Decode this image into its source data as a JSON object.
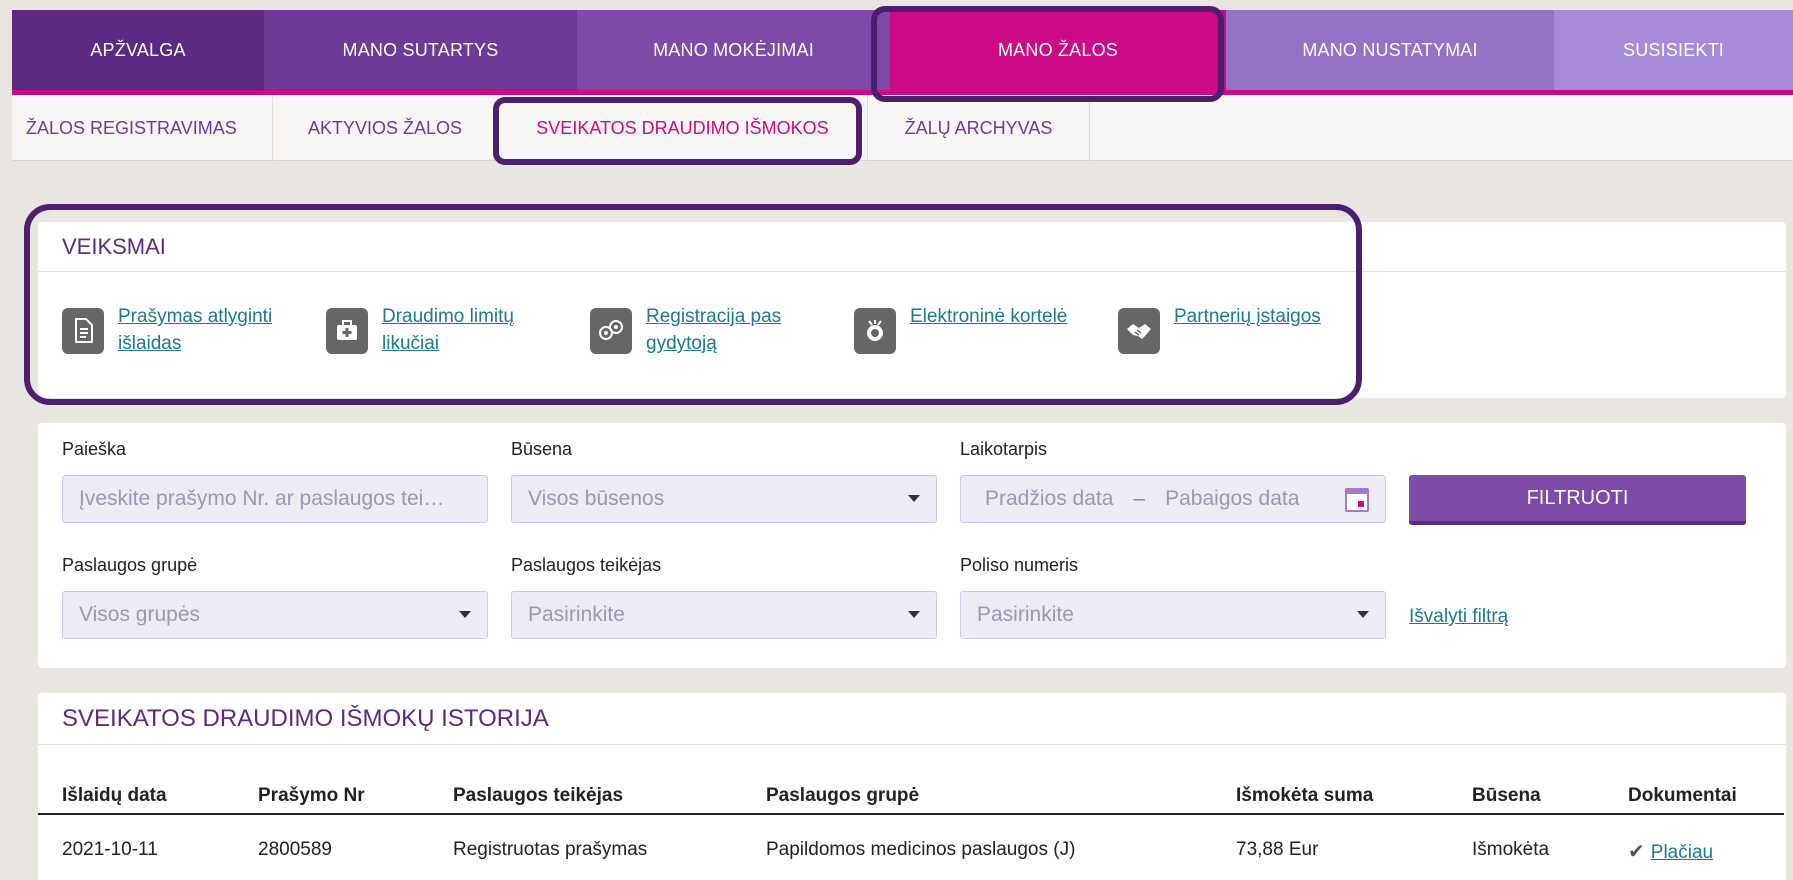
{
  "top_nav": [
    "APŽVALGA",
    "MANO SUTARTYS",
    "MANO MOKĖJIMAI",
    "MANO ŽALOS",
    "MANO NUSTATYMAI",
    "SUSISIEKTI"
  ],
  "sub_nav": [
    "ŽALOS REGISTRAVIMAS",
    "AKTYVIOS ŽALOS",
    "SVEIKATOS DRAUDIMO IŠMOKOS",
    "ŽALŲ ARCHYVAS"
  ],
  "actions": {
    "title": "VEIKSMAI",
    "items": [
      {
        "label": "Prašymas atlyginti išlaidas",
        "icon": "document-icon"
      },
      {
        "label": "Draudimo limitų likučiai",
        "icon": "medical-kit-icon"
      },
      {
        "label": "Registracija pas gydytoją",
        "icon": "doctor-icon"
      },
      {
        "label": "Elektroninė kortelė",
        "icon": "card-icon"
      },
      {
        "label": "Partnerių įstaigos",
        "icon": "handshake-icon"
      }
    ]
  },
  "filters": {
    "search_label": "Paieška",
    "search_placeholder": "Įveskite prašymo Nr. ar paslaugos tei…",
    "status_label": "Būsena",
    "status_value": "Visos būsenos",
    "period_label": "Laikotarpis",
    "period_start": "Pradžios data",
    "period_sep": "–",
    "period_end": "Pabaigos data",
    "filter_button": "FILTRUOTI",
    "group_label": "Paslaugos grupė",
    "group_value": "Visos grupės",
    "provider_label": "Paslaugos teikėjas",
    "provider_value": "Pasirinkite",
    "policy_label": "Poliso numeris",
    "policy_value": "Pasirinkite",
    "clear_link": "Išvalyti filtrą"
  },
  "history": {
    "title": "SVEIKATOS DRAUDIMO IŠMOKŲ ISTORIJA",
    "columns": [
      "Išlaidų data",
      "Prašymo Nr",
      "Paslaugos teikėjas",
      "Paslaugos grupė",
      "Išmokėta suma",
      "Būsena",
      "Dokumentai"
    ],
    "rows": [
      {
        "date": "2021-10-11",
        "number": "2800589",
        "provider": "Registruotas prašymas",
        "group": "Papildomos medicinos paslaugos (J)",
        "amount": "73,88 Eur",
        "status": "Išmokėta",
        "docs": "Plačiau"
      }
    ]
  }
}
